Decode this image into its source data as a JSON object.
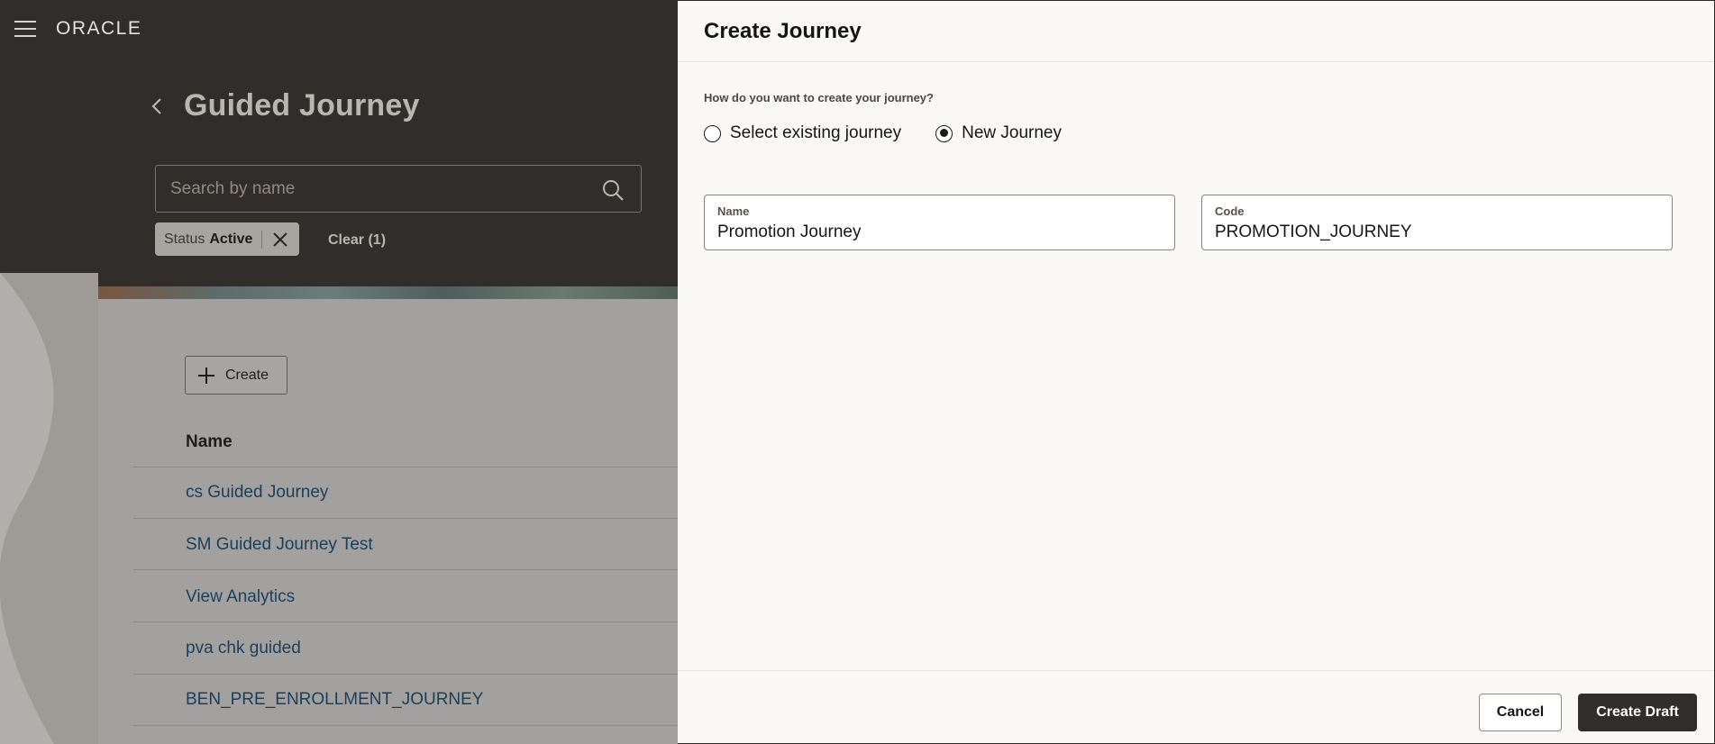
{
  "app": {
    "logo": "ORACLE",
    "page_title": "Guided Journey"
  },
  "search": {
    "placeholder": "Search by name",
    "value": ""
  },
  "filter": {
    "chip_label": "Status",
    "chip_value": "Active",
    "clear_label": "Clear (1)"
  },
  "list": {
    "create_label": "Create",
    "column_header": "Name",
    "items": [
      "cs Guided Journey",
      "SM Guided Journey Test",
      "View Analytics",
      "pva chk guided",
      "BEN_PRE_ENROLLMENT_JOURNEY"
    ]
  },
  "drawer": {
    "title": "Create Journey",
    "question": "How do you want to create your journey?",
    "options": [
      {
        "label": "Select existing journey",
        "selected": false
      },
      {
        "label": "New Journey",
        "selected": true
      }
    ],
    "name_label": "Name",
    "name_value": "Promotion Journey",
    "code_label": "Code",
    "code_value": "PROMOTION_JOURNEY",
    "cancel_label": "Cancel",
    "submit_label": "Create Draft"
  },
  "icons": {
    "menu": "hamburger-menu-icon",
    "back": "chevron-left-icon",
    "search": "search-icon",
    "close": "close-icon",
    "plus": "plus-icon"
  },
  "colors": {
    "header_bg": "#312d2a",
    "link": "#1b3f58",
    "primary_button": "#312d2a",
    "drawer_bg": "#fbf9f8"
  }
}
